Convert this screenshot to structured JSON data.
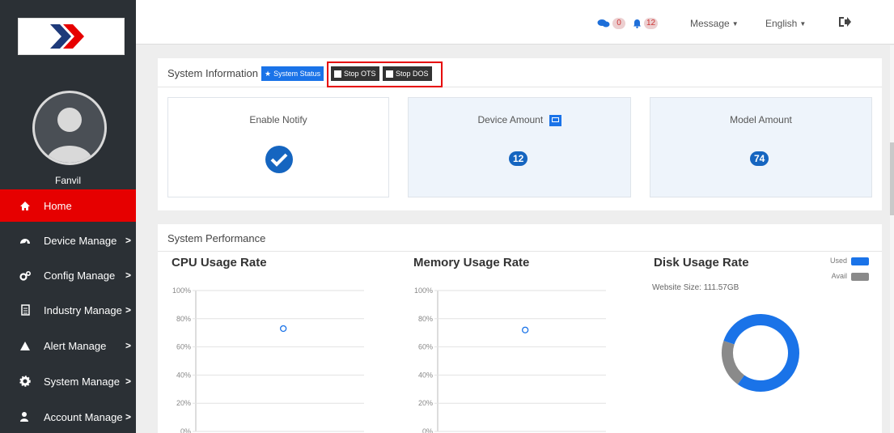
{
  "sidebar": {
    "user_name": "Fanvil",
    "items": [
      {
        "label": "Home",
        "icon": "home-icon",
        "has_arrow": false
      },
      {
        "label": "Device Manage",
        "icon": "dashboard-icon",
        "has_arrow": true
      },
      {
        "label": "Config Manage",
        "icon": "cogs-icon",
        "has_arrow": true
      },
      {
        "label": "Industry Manage",
        "icon": "document-icon",
        "has_arrow": true
      },
      {
        "label": "Alert Manage",
        "icon": "warning-icon",
        "has_arrow": true
      },
      {
        "label": "System Manage",
        "icon": "gear-icon",
        "has_arrow": true
      },
      {
        "label": "Account Manage",
        "icon": "users-icon",
        "has_arrow": true
      }
    ],
    "arrow": ">"
  },
  "topbar": {
    "comments_count": "0",
    "alerts_count": "12",
    "message_label": "Message",
    "language_label": "English"
  },
  "system_info": {
    "title": "System Information",
    "system_status_btn": "System Status",
    "stop_ots_btn": "Stop OTS",
    "stop_dos_btn": "Stop DOS",
    "enable_notify_label": "Enable Notify",
    "device_amount_label": "Device Amount",
    "device_amount_value": "12",
    "model_amount_label": "Model Amount",
    "model_amount_value": "74"
  },
  "performance": {
    "title": "System Performance",
    "cpu_title": "CPU Usage Rate",
    "memory_title": "Memory Usage Rate",
    "disk_title": "Disk Usage Rate",
    "website_size": "Website Size: 111.57GB",
    "y_ticks": [
      "100%",
      "80%",
      "60%",
      "40%",
      "20%",
      "0%"
    ],
    "legend_used": "Used",
    "legend_avail": "Avail"
  },
  "colors": {
    "accent_red": "#e60000",
    "primary_blue": "#1a73e8",
    "dark_blue": "#1565c0",
    "sidebar_bg": "#2b3035",
    "avail_gray": "#8a8a8a"
  },
  "chart_data": [
    {
      "type": "scatter",
      "title": "CPU Usage Rate",
      "ylim": [
        0,
        100
      ],
      "y_ticks": [
        "100%",
        "80%",
        "60%",
        "40%",
        "20%",
        "0%"
      ],
      "points": [
        {
          "y": 73
        }
      ]
    },
    {
      "type": "scatter",
      "title": "Memory Usage Rate",
      "ylim": [
        0,
        100
      ],
      "y_ticks": [
        "100%",
        "80%",
        "60%",
        "40%",
        "20%",
        "0%"
      ],
      "points": [
        {
          "y": 72
        }
      ]
    },
    {
      "type": "pie",
      "title": "Disk Usage Rate",
      "categories": [
        "Used",
        "Avail"
      ],
      "values": [
        80,
        20
      ],
      "colors": [
        "#1a73e8",
        "#8a8a8a"
      ]
    }
  ]
}
